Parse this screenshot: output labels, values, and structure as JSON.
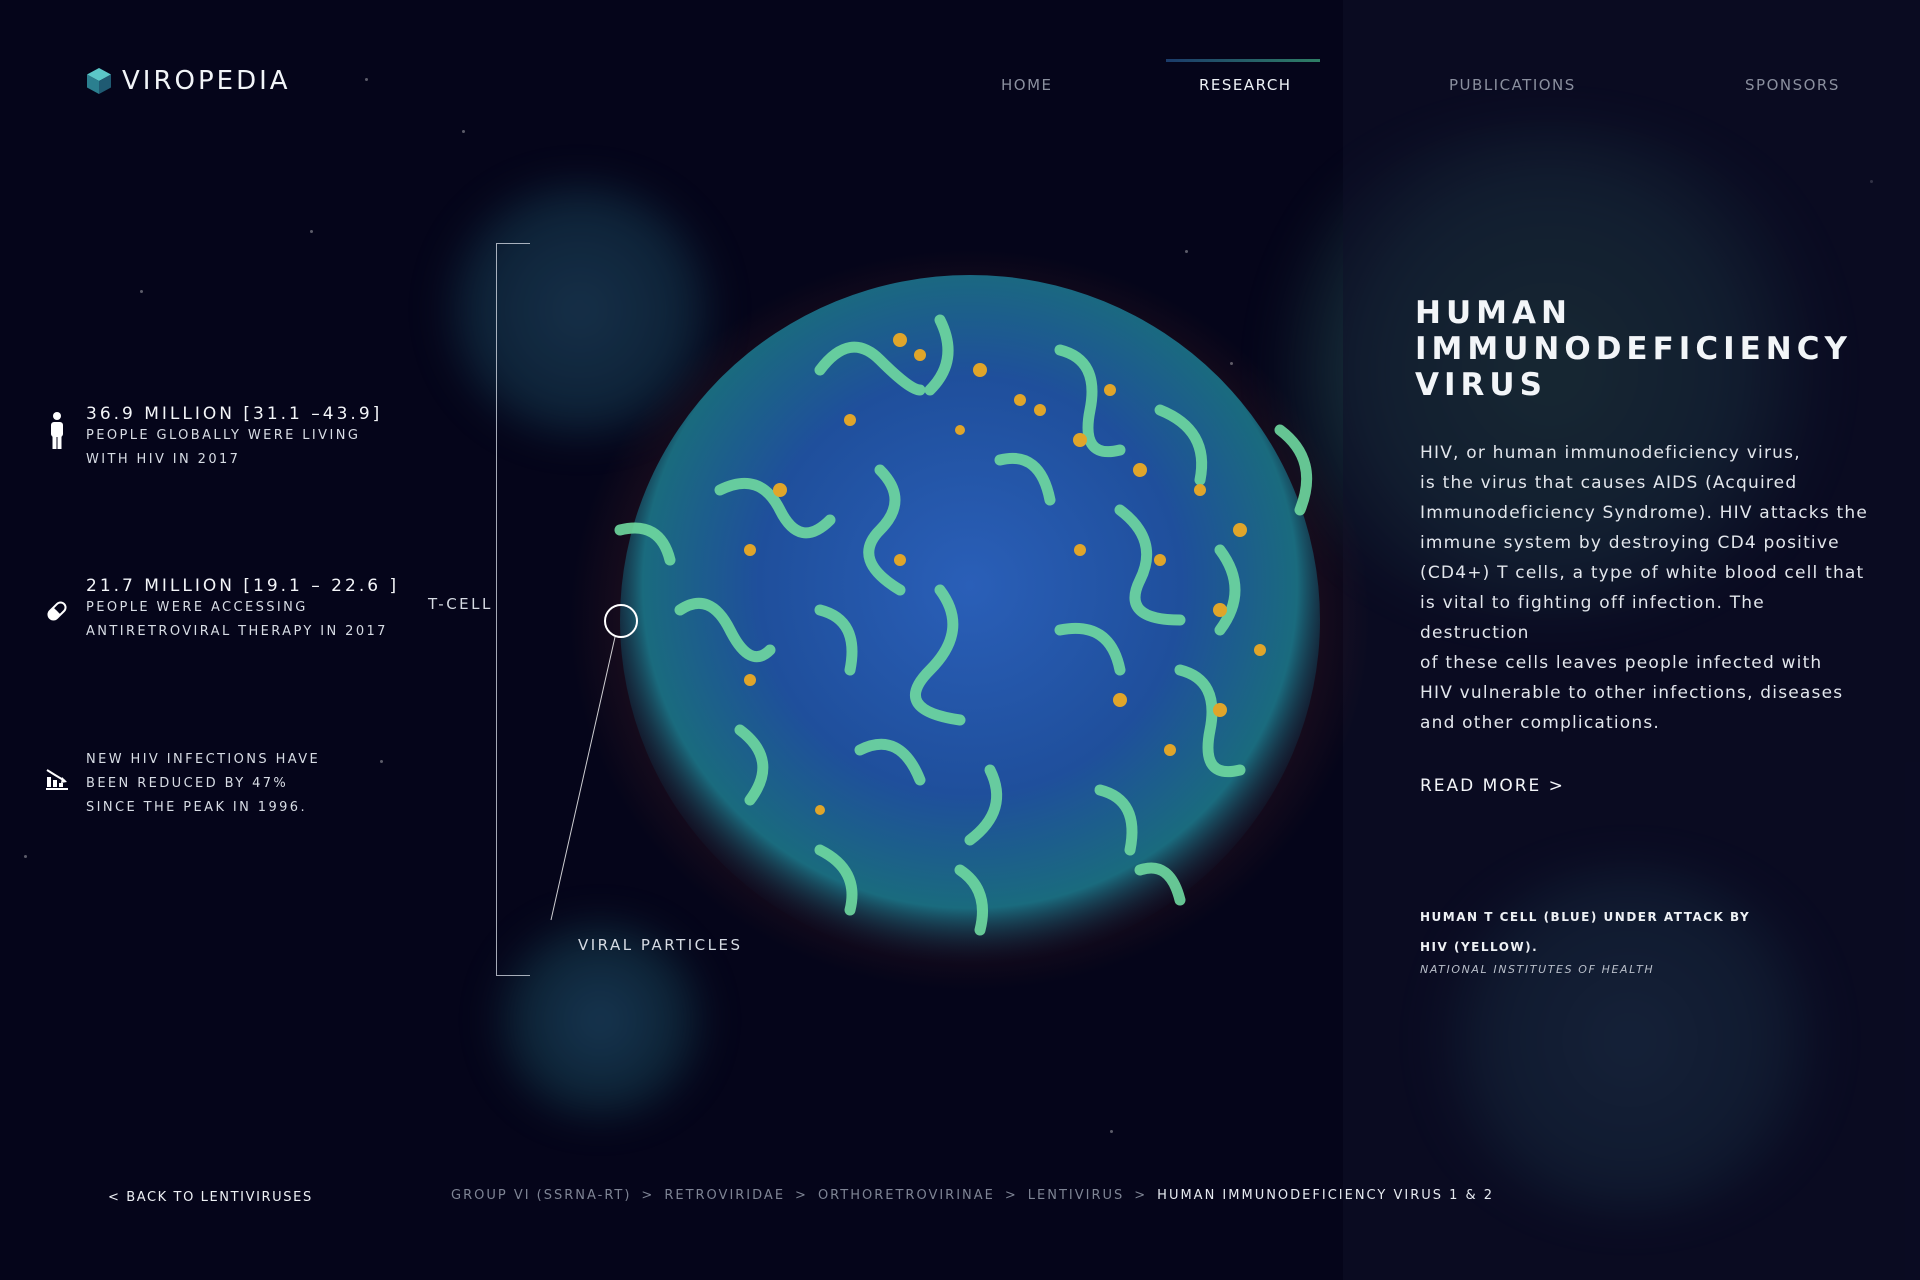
{
  "brand": {
    "name": "VIROPEDIA",
    "logo_icon": "cube-logo-icon",
    "accent": "#2f9a86"
  },
  "nav": {
    "items": [
      {
        "label": "HOME",
        "active": false
      },
      {
        "label": "RESEARCH",
        "active": true
      },
      {
        "label": "PUBLICATIONS",
        "active": false
      },
      {
        "label": "SPONSORS",
        "active": false
      }
    ]
  },
  "stats": [
    {
      "icon": "person-icon",
      "headline": "36.9 MILLION [31.1 –43.9]",
      "lines": [
        "PEOPLE GLOBALLY WERE LIVING",
        "WITH HIV IN 2017"
      ]
    },
    {
      "icon": "pill-icon",
      "headline": "21.7 MILLION [19.1 – 22.6 ]",
      "lines": [
        "PEOPLE WERE ACCESSING",
        "ANTIRETROVIRAL THERAPY IN 2017"
      ]
    },
    {
      "icon": "declining-chart-icon",
      "headline": "",
      "lines": [
        "NEW HIV INFECTIONS HAVE",
        "BEEN REDUCED BY 47%",
        "SINCE THE PEAK IN 1996."
      ]
    }
  ],
  "image_labels": {
    "tcell": "T-CELL",
    "viral": "VIRAL PARTICLES"
  },
  "article": {
    "title_lines": [
      "HUMAN",
      "IMMUNODEFICIENCY",
      "VIRUS"
    ],
    "description_lines": [
      "HIV, or human immunodeficiency virus,",
      "is the virus that causes AIDS (Acquired",
      "Immunodeficiency Syndrome). HIV attacks the",
      "immune system by destroying CD4 positive",
      "(CD4+) T cells, a type of white blood cell that",
      "is vital to fighting off infection. The",
      "destruction",
      "of these cells leaves people infected with",
      "HIV vulnerable to other infections, diseases",
      "and other complications."
    ],
    "read_more": "READ MORE >",
    "caption_lines": [
      "HUMAN T CELL (BLUE) UNDER ATTACK BY",
      "HIV (YELLOW)."
    ],
    "credit": "NATIONAL INSTITUTES OF HEALTH"
  },
  "footer": {
    "back": "< BACK TO LENTIVIRUSES",
    "breadcrumb": [
      "GROUP VI (SSRNA-RT)",
      "RETROVIRIDAE",
      "ORTHORETROVIRINAE",
      "LENTIVIRUS",
      "HUMAN IMMUNODEFICIENCY VIRUS 1 & 2"
    ],
    "separator": ">"
  },
  "colors": {
    "background": "#05051a",
    "cell_blue": "#1f4fa3",
    "cell_green": "#5fd39a",
    "virus_yellow": "#e0a52a"
  }
}
